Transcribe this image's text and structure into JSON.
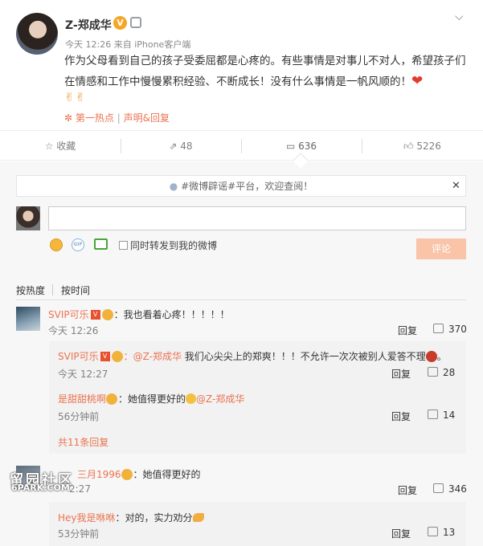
{
  "post": {
    "author": "Z-郑成华",
    "time": "今天 12:26",
    "source": "来自 iPhone客户端",
    "text": "作为父母看到自己的孩子受委屈都是心疼的。有些事情是对事儿不对人，希望孩子们在情感和工作中慢慢累积经验、不断成长！没有什么事情是一帆风顺的！",
    "victory_emoji": "✌✌",
    "tag_hot": "第一热点",
    "tag_sep": "|",
    "tag_statement": "声明&回复"
  },
  "actions": {
    "favorite": "收藏",
    "forward_count": "48",
    "comment_count": "636",
    "like_count": "5226"
  },
  "notice": {
    "text": "#微博辟谣#平台，欢迎查阅！",
    "close": "✕"
  },
  "composer": {
    "repost_label": "同时转发到我的微博",
    "submit_label": "评论"
  },
  "sort": {
    "hot": "按热度",
    "time": "按时间"
  },
  "comments": [
    {
      "user": "SVIP可乐",
      "text": "：我也看着心疼！！！！！",
      "time": "今天 12:26",
      "reply": "回复",
      "likes": "370"
    }
  ],
  "replies": [
    {
      "user": "SVIP可乐",
      "mention": "：@Z-郑成华",
      "text": " 我们心尖尖上的郑爽！！！不允许一次次被别人爱答不理",
      "time": "今天 12:27",
      "reply": "回复",
      "likes": "28"
    },
    {
      "user": "是甜甜桃啊",
      "text": "：她值得更好的",
      "mention": "@Z-郑成华",
      "time": "56分钟前",
      "reply": "回复",
      "likes": "14"
    }
  ],
  "more_replies": "共11条回复",
  "comment2": {
    "user": "三月1996",
    "text": "：她值得更好的",
    "time": "2:27",
    "reply": "回复",
    "likes": "346"
  },
  "reply3": {
    "user": "Hey我是咻咻",
    "text": "：对的，实力劝分",
    "time": "53分钟前",
    "reply": "回复",
    "likes": "13"
  },
  "watermark": {
    "line1": "留园社区",
    "line2": "6PARK.COM"
  },
  "colors": {
    "accent_orange": "#eb7350",
    "submit_disabled": "#f9c4a8",
    "verified_gold": "#f5a623"
  }
}
